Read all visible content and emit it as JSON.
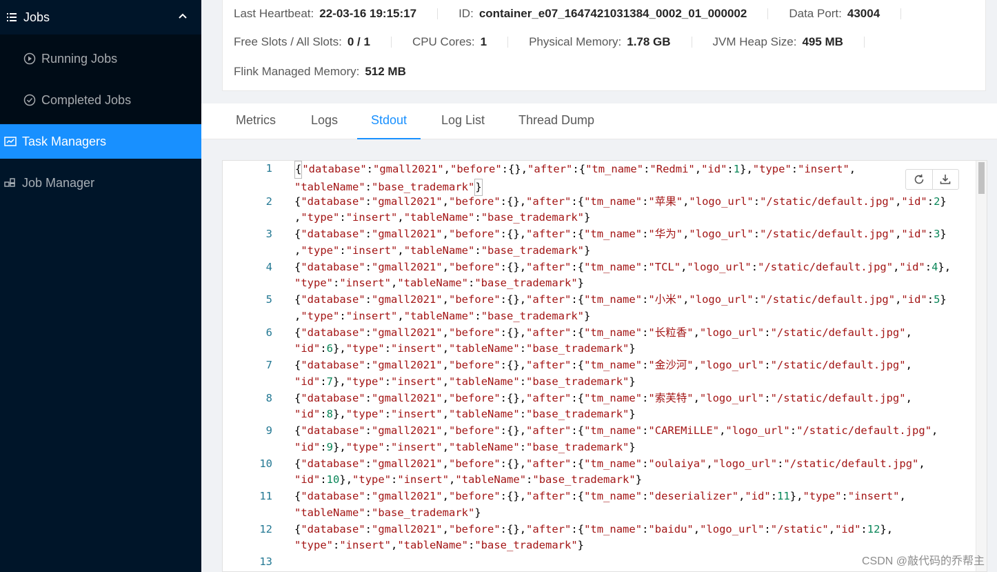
{
  "sidebar": {
    "jobs_label": "Jobs",
    "running_jobs": "Running Jobs",
    "completed_jobs": "Completed Jobs",
    "task_managers": "Task Managers",
    "job_manager": "Job Manager"
  },
  "info": {
    "last_heartbeat_label": "Last Heartbeat:",
    "last_heartbeat": "22-03-16 19:15:17",
    "id_label": "ID:",
    "id": "container_e07_1647421031384_0002_01_000002",
    "data_port_label": "Data Port:",
    "data_port": "43004",
    "free_slots_label": "Free Slots / All Slots:",
    "free_slots": "0 / 1",
    "cpu_cores_label": "CPU Cores:",
    "cpu_cores": "1",
    "physical_memory_label": "Physical Memory:",
    "physical_memory": "1.78 GB",
    "jvm_heap_label": "JVM Heap Size:",
    "jvm_heap": "495 MB",
    "flink_memory_label": "Flink Managed Memory:",
    "flink_memory": "512 MB"
  },
  "tabs": [
    "Metrics",
    "Logs",
    "Stdout",
    "Log List",
    "Thread Dump"
  ],
  "active_tab": "Stdout",
  "code": {
    "lines": [
      {
        "n": "1",
        "text": "{\"database\":\"gmall2021\",\"before\":{},\"after\":{\"tm_name\":\"Redmi\",\"id\":1},\"type\":\"insert\",\n\"tableName\":\"base_trademark\"}"
      },
      {
        "n": "2",
        "text": "{\"database\":\"gmall2021\",\"before\":{},\"after\":{\"tm_name\":\"苹果\",\"logo_url\":\"/static/default.jpg\",\"id\":2}\n,\"type\":\"insert\",\"tableName\":\"base_trademark\"}"
      },
      {
        "n": "3",
        "text": "{\"database\":\"gmall2021\",\"before\":{},\"after\":{\"tm_name\":\"华为\",\"logo_url\":\"/static/default.jpg\",\"id\":3}\n,\"type\":\"insert\",\"tableName\":\"base_trademark\"}"
      },
      {
        "n": "4",
        "text": "{\"database\":\"gmall2021\",\"before\":{},\"after\":{\"tm_name\":\"TCL\",\"logo_url\":\"/static/default.jpg\",\"id\":4},\n\"type\":\"insert\",\"tableName\":\"base_trademark\"}"
      },
      {
        "n": "5",
        "text": "{\"database\":\"gmall2021\",\"before\":{},\"after\":{\"tm_name\":\"小米\",\"logo_url\":\"/static/default.jpg\",\"id\":5}\n,\"type\":\"insert\",\"tableName\":\"base_trademark\"}"
      },
      {
        "n": "6",
        "text": "{\"database\":\"gmall2021\",\"before\":{},\"after\":{\"tm_name\":\"长粒香\",\"logo_url\":\"/static/default.jpg\",\n\"id\":6},\"type\":\"insert\",\"tableName\":\"base_trademark\"}"
      },
      {
        "n": "7",
        "text": "{\"database\":\"gmall2021\",\"before\":{},\"after\":{\"tm_name\":\"金沙河\",\"logo_url\":\"/static/default.jpg\",\n\"id\":7},\"type\":\"insert\",\"tableName\":\"base_trademark\"}"
      },
      {
        "n": "8",
        "text": "{\"database\":\"gmall2021\",\"before\":{},\"after\":{\"tm_name\":\"索芙特\",\"logo_url\":\"/static/default.jpg\",\n\"id\":8},\"type\":\"insert\",\"tableName\":\"base_trademark\"}"
      },
      {
        "n": "9",
        "text": "{\"database\":\"gmall2021\",\"before\":{},\"after\":{\"tm_name\":\"CAREMiLLE\",\"logo_url\":\"/static/default.jpg\",\n\"id\":9},\"type\":\"insert\",\"tableName\":\"base_trademark\"}"
      },
      {
        "n": "10",
        "text": "{\"database\":\"gmall2021\",\"before\":{},\"after\":{\"tm_name\":\"oulaiya\",\"logo_url\":\"/static/default.jpg\",\n\"id\":10},\"type\":\"insert\",\"tableName\":\"base_trademark\"}"
      },
      {
        "n": "11",
        "text": "{\"database\":\"gmall2021\",\"before\":{},\"after\":{\"tm_name\":\"deserializer\",\"id\":11},\"type\":\"insert\",\n\"tableName\":\"base_trademark\"}"
      },
      {
        "n": "12",
        "text": "{\"database\":\"gmall2021\",\"before\":{},\"after\":{\"tm_name\":\"baidu\",\"logo_url\":\"/static\",\"id\":12},\n\"type\":\"insert\",\"tableName\":\"base_trademark\"}"
      },
      {
        "n": "13",
        "text": ""
      }
    ]
  },
  "watermark": "CSDN @敲代码的乔帮主",
  "colors": {
    "sidebar_bg": "#001529",
    "submenu_bg": "#000c17",
    "accent": "#1890ff",
    "string": "#a31515",
    "number": "#098658",
    "line_number": "#237893"
  }
}
